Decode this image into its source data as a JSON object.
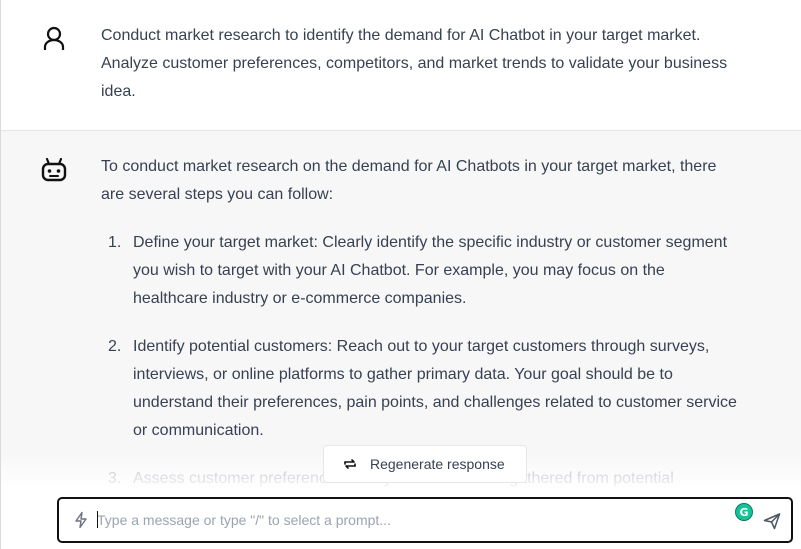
{
  "conversation": {
    "user_message": {
      "avatar_icon": "user-icon",
      "text": "Conduct market research to identify the demand for AI Chatbot in your target market. Analyze customer preferences, competitors, and market trends to validate your business idea."
    },
    "bot_message": {
      "avatar_icon": "robot-icon",
      "intro": "To conduct market research on the demand for AI Chatbots in your target market, there are several steps you can follow:",
      "steps": [
        {
          "number": "1.",
          "text": "Define your target market: Clearly identify the specific industry or customer segment you wish to target with your AI Chatbot. For example, you may focus on the healthcare industry or e-commerce companies."
        },
        {
          "number": "2.",
          "text": "Identify potential customers: Reach out to your target customers through surveys, interviews, or online platforms to gather primary data. Your goal should be to understand their preferences, pain points, and challenges related to customer service or communication."
        },
        {
          "number": "3.",
          "text": "Assess customer preferences: Analyze the feedback gathered from potential"
        }
      ]
    }
  },
  "regenerate": {
    "label": "Regenerate response",
    "icon": "refresh-icon"
  },
  "composer": {
    "placeholder": "Type a message or type \"/\" to select a prompt...",
    "value": "",
    "prompt_icon": "bolt-icon",
    "send_icon": "send-icon",
    "grammarly_badge": "G"
  },
  "colors": {
    "bot_background": "#f7f7f8",
    "text": "#374151",
    "composer_border": "#111111",
    "grammarly": "#15c39a"
  }
}
